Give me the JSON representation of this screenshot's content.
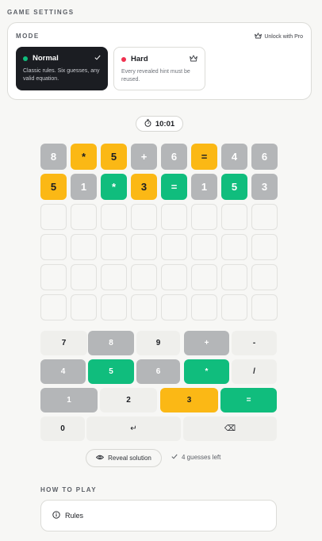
{
  "settings": {
    "section_label": "GAME SETTINGS",
    "mode_label": "MODE",
    "unlock_label": "Unlock with Pro",
    "modes": [
      {
        "title": "Normal",
        "desc": "Classic rules. Six guesses, any valid equation.",
        "dot_color": "#10bd7d",
        "selected": true
      },
      {
        "title": "Hard",
        "desc": "Every revealed hint must be reused.",
        "dot_color": "#f0304f",
        "selected": false
      }
    ]
  },
  "timer": {
    "value": "10:01"
  },
  "board": {
    "rows": [
      [
        {
          "ch": "8",
          "state": "gray"
        },
        {
          "ch": "*",
          "state": "yellow"
        },
        {
          "ch": "5",
          "state": "yellow"
        },
        {
          "ch": "+",
          "state": "gray"
        },
        {
          "ch": "6",
          "state": "gray"
        },
        {
          "ch": "=",
          "state": "yellow"
        },
        {
          "ch": "4",
          "state": "gray"
        },
        {
          "ch": "6",
          "state": "gray"
        }
      ],
      [
        {
          "ch": "5",
          "state": "yellow"
        },
        {
          "ch": "1",
          "state": "gray"
        },
        {
          "ch": "*",
          "state": "green"
        },
        {
          "ch": "3",
          "state": "yellow"
        },
        {
          "ch": "=",
          "state": "green"
        },
        {
          "ch": "1",
          "state": "gray"
        },
        {
          "ch": "5",
          "state": "green"
        },
        {
          "ch": "3",
          "state": "gray"
        }
      ],
      [
        {
          "ch": "",
          "state": "empty"
        },
        {
          "ch": "",
          "state": "empty"
        },
        {
          "ch": "",
          "state": "empty"
        },
        {
          "ch": "",
          "state": "empty"
        },
        {
          "ch": "",
          "state": "empty"
        },
        {
          "ch": "",
          "state": "empty"
        },
        {
          "ch": "",
          "state": "empty"
        },
        {
          "ch": "",
          "state": "empty"
        }
      ],
      [
        {
          "ch": "",
          "state": "empty"
        },
        {
          "ch": "",
          "state": "empty"
        },
        {
          "ch": "",
          "state": "empty"
        },
        {
          "ch": "",
          "state": "empty"
        },
        {
          "ch": "",
          "state": "empty"
        },
        {
          "ch": "",
          "state": "empty"
        },
        {
          "ch": "",
          "state": "empty"
        },
        {
          "ch": "",
          "state": "empty"
        }
      ],
      [
        {
          "ch": "",
          "state": "empty"
        },
        {
          "ch": "",
          "state": "empty"
        },
        {
          "ch": "",
          "state": "empty"
        },
        {
          "ch": "",
          "state": "empty"
        },
        {
          "ch": "",
          "state": "empty"
        },
        {
          "ch": "",
          "state": "empty"
        },
        {
          "ch": "",
          "state": "empty"
        },
        {
          "ch": "",
          "state": "empty"
        }
      ],
      [
        {
          "ch": "",
          "state": "empty"
        },
        {
          "ch": "",
          "state": "empty"
        },
        {
          "ch": "",
          "state": "empty"
        },
        {
          "ch": "",
          "state": "empty"
        },
        {
          "ch": "",
          "state": "empty"
        },
        {
          "ch": "",
          "state": "empty"
        },
        {
          "ch": "",
          "state": "empty"
        },
        {
          "ch": "",
          "state": "empty"
        }
      ]
    ]
  },
  "keyboard": {
    "rows": [
      [
        {
          "label": "7",
          "state": "default"
        },
        {
          "label": "8",
          "state": "gray"
        },
        {
          "label": "9",
          "state": "default"
        },
        {
          "label": "+",
          "state": "gray"
        },
        {
          "label": "-",
          "state": "default"
        }
      ],
      [
        {
          "label": "4",
          "state": "gray"
        },
        {
          "label": "5",
          "state": "green"
        },
        {
          "label": "6",
          "state": "gray"
        },
        {
          "label": "*",
          "state": "green"
        },
        {
          "label": "/",
          "state": "default"
        }
      ],
      [
        {
          "label": "1",
          "state": "gray"
        },
        {
          "label": "2",
          "state": "default"
        },
        {
          "label": "3",
          "state": "yellow"
        },
        {
          "label": "=",
          "state": "green"
        }
      ],
      [
        {
          "label": "0",
          "state": "default",
          "icon": "digit"
        },
        {
          "label": "↵",
          "state": "default",
          "icon": "enter-icon"
        },
        {
          "label": "⌫",
          "state": "default",
          "icon": "backspace-icon"
        }
      ]
    ]
  },
  "actions": {
    "reveal_label": "Reveal solution",
    "guesses_left": "4 guesses left"
  },
  "howto": {
    "section_label": "HOW TO PLAY",
    "rules_label": "Rules"
  },
  "colors": {
    "gray": "#b4b6b8",
    "yellow": "#fbb815",
    "green": "#10bd7d",
    "dark": "#1b1d22"
  }
}
